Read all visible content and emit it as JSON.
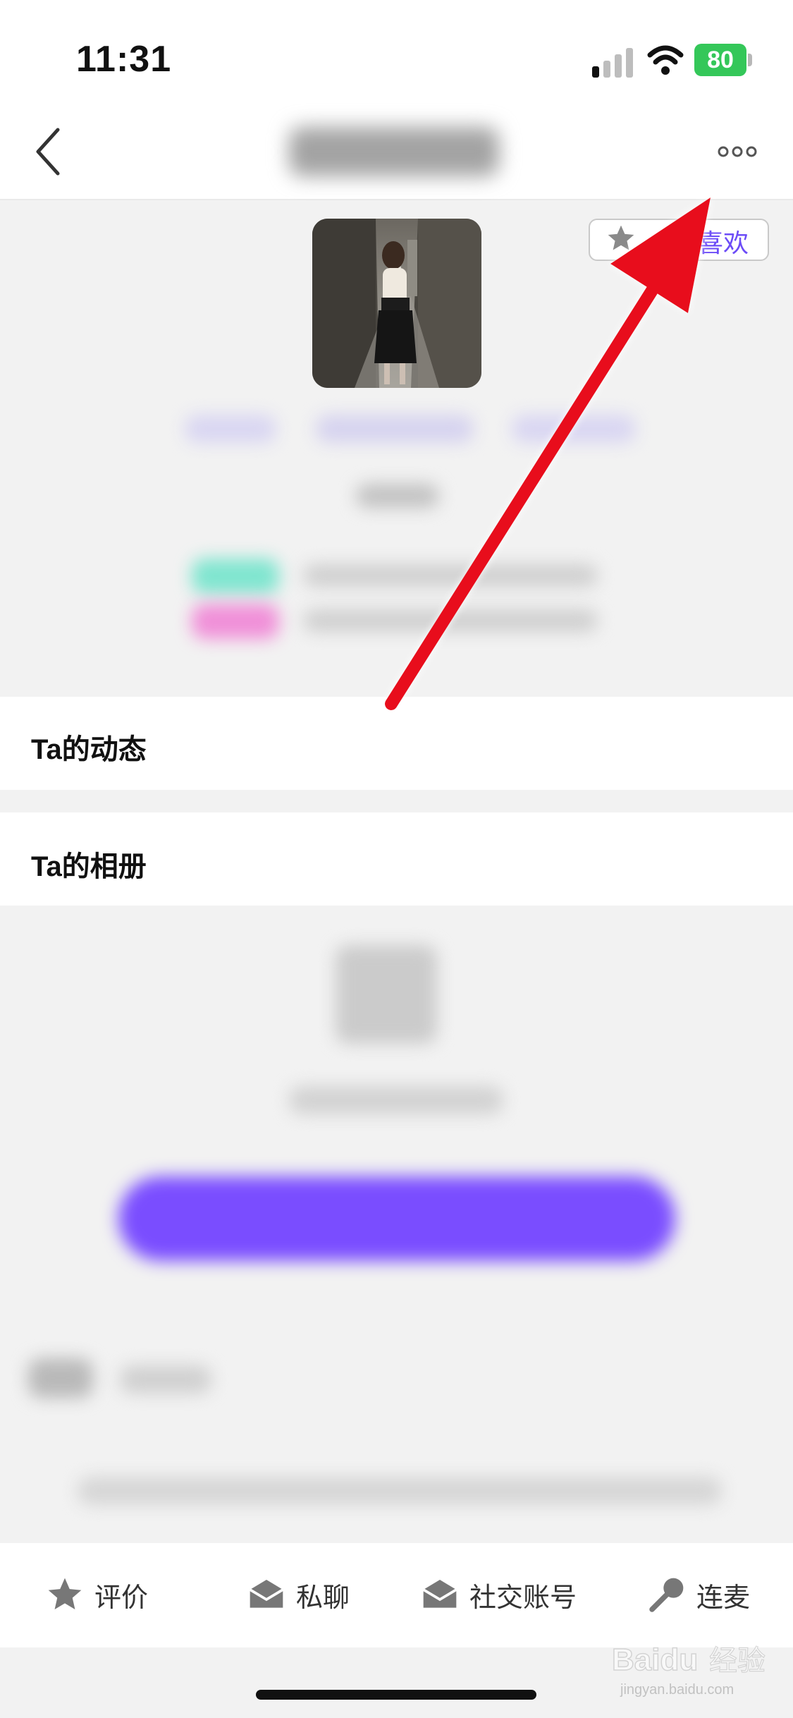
{
  "status_bar": {
    "time": "11:31",
    "battery": "80"
  },
  "profile": {
    "like_label": "喜欢"
  },
  "sections": {
    "moments": "Ta的动态",
    "album": "Ta的相册"
  },
  "bottom_tabs": [
    {
      "label": "评价",
      "icon": "star-icon"
    },
    {
      "label": "私聊",
      "icon": "mail-icon"
    },
    {
      "label": "社交账号",
      "icon": "mail-icon"
    },
    {
      "label": "连麦",
      "icon": "microphone-icon"
    }
  ],
  "watermark": {
    "brand": "Baidu",
    "sub": "经验",
    "url": "jingyan.baidu.com"
  },
  "colors": {
    "accent": "#6c4cf7",
    "arrow": "#e8101b",
    "battery": "#34c759"
  }
}
